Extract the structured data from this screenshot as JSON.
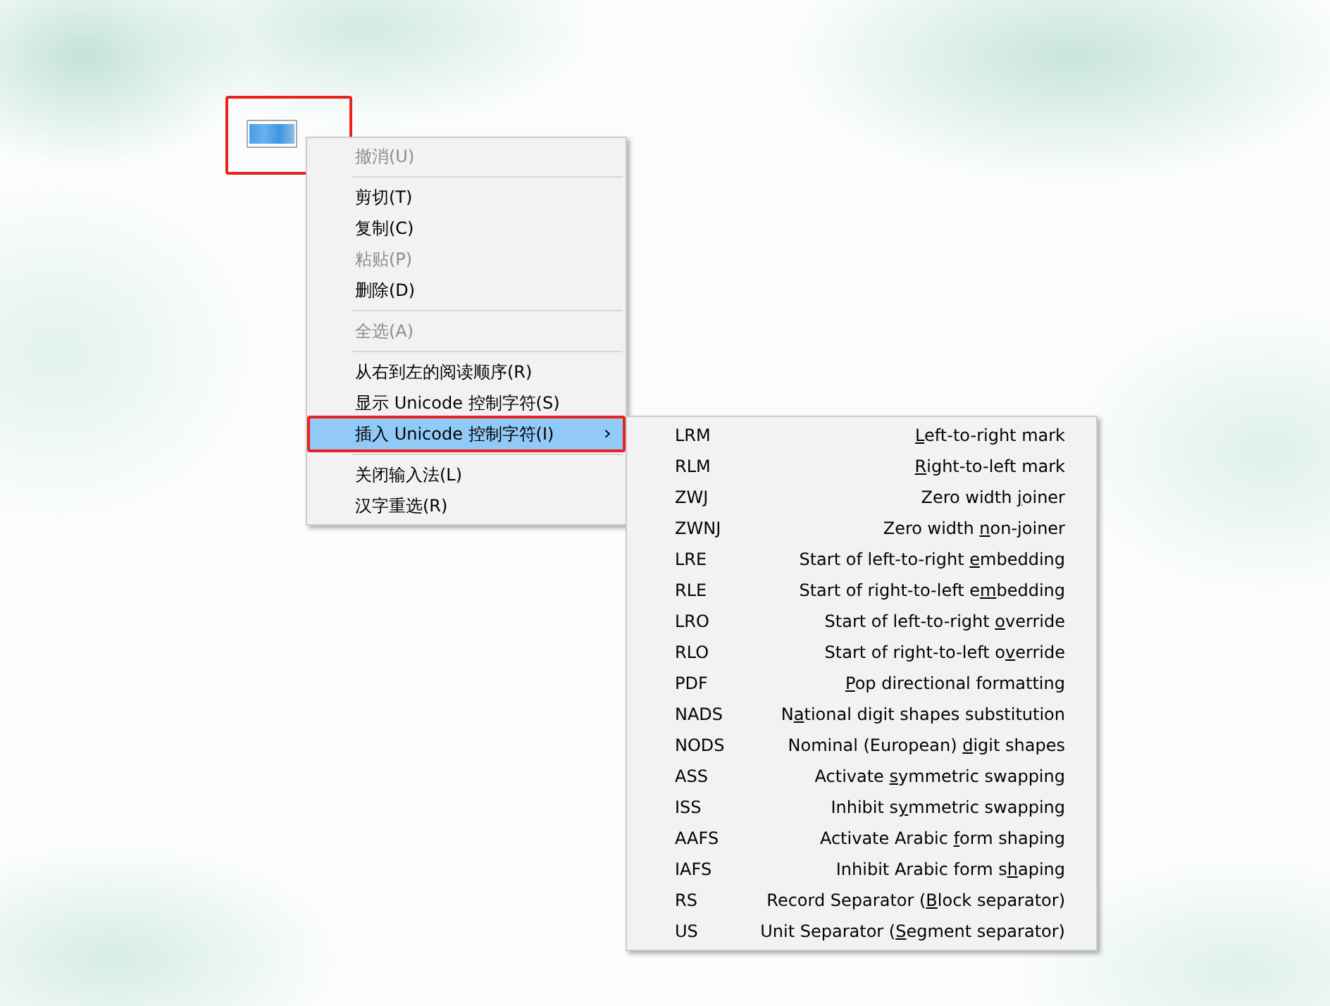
{
  "text_field": {
    "selected_text_blurred": true,
    "annotated": true
  },
  "context_menu": {
    "items": [
      {
        "kind": "item",
        "label": "撤消(U)",
        "disabled": true,
        "selected": false,
        "annotated": false
      },
      {
        "kind": "separator"
      },
      {
        "kind": "item",
        "label": "剪切(T)",
        "disabled": false,
        "selected": false,
        "annotated": false
      },
      {
        "kind": "item",
        "label": "复制(C)",
        "disabled": false,
        "selected": false,
        "annotated": false
      },
      {
        "kind": "item",
        "label": "粘贴(P)",
        "disabled": true,
        "selected": false,
        "annotated": false
      },
      {
        "kind": "item",
        "label": "删除(D)",
        "disabled": false,
        "selected": false,
        "annotated": false
      },
      {
        "kind": "separator"
      },
      {
        "kind": "item",
        "label": "全选(A)",
        "disabled": true,
        "selected": false,
        "annotated": false
      },
      {
        "kind": "separator"
      },
      {
        "kind": "item",
        "label": "从右到左的阅读顺序(R)",
        "disabled": false,
        "selected": false,
        "annotated": false
      },
      {
        "kind": "item",
        "label": "显示 Unicode 控制字符(S)",
        "disabled": false,
        "selected": false,
        "annotated": false
      },
      {
        "kind": "item",
        "label": "插入 Unicode 控制字符(I)",
        "disabled": false,
        "selected": true,
        "submenu_arrow": "›",
        "annotated": true
      },
      {
        "kind": "separator"
      },
      {
        "kind": "item",
        "label": "关闭输入法(L)",
        "disabled": false,
        "selected": false,
        "annotated": false
      },
      {
        "kind": "item",
        "label": "汉字重选(R)",
        "disabled": false,
        "selected": false,
        "annotated": false
      }
    ]
  },
  "submenu": {
    "items": [
      {
        "code": "LRM",
        "access_key": "L",
        "after": "eft-to-right mark"
      },
      {
        "code": "RLM",
        "access_key": "R",
        "after": "ight-to-left mark"
      },
      {
        "code": "ZWJ",
        "before": "Zero width ",
        "access_key": "j",
        "after": "oiner"
      },
      {
        "code": "ZWNJ",
        "before": "Zero width ",
        "access_key": "n",
        "after": "on-joiner"
      },
      {
        "code": "LRE",
        "before": "Start of left-to-right ",
        "access_key": "e",
        "after": "mbedding"
      },
      {
        "code": "RLE",
        "before": "Start of right-to-left e",
        "access_key": "m",
        "after": "bedding"
      },
      {
        "code": "LRO",
        "before": "Start of left-to-right ",
        "access_key": "o",
        "after": "verride"
      },
      {
        "code": "RLO",
        "before": "Start of right-to-left o",
        "access_key": "v",
        "after": "erride"
      },
      {
        "code": "PDF",
        "access_key": "P",
        "after": "op directional formatting"
      },
      {
        "code": "NADS",
        "before": "N",
        "access_key": "a",
        "after": "tional digit shapes substitution"
      },
      {
        "code": "NODS",
        "before": "Nominal (European) ",
        "access_key": "d",
        "after": "igit shapes"
      },
      {
        "code": "ASS",
        "before": "Activate ",
        "access_key": "s",
        "after": "ymmetric swapping"
      },
      {
        "code": "ISS",
        "before": "Inhibit s",
        "access_key": "y",
        "after": "mmetric swapping"
      },
      {
        "code": "AAFS",
        "before": "Activate Arabic ",
        "access_key": "f",
        "after": "orm shaping"
      },
      {
        "code": "IAFS",
        "before": "Inhibit Arabic form s",
        "access_key": "h",
        "after": "aping"
      },
      {
        "code": "RS",
        "before": "Record Separator (",
        "access_key": "B",
        "after": "lock separator)"
      },
      {
        "code": "US",
        "before": "Unit Separator (",
        "access_key": "S",
        "after": "egment separator)"
      }
    ]
  }
}
